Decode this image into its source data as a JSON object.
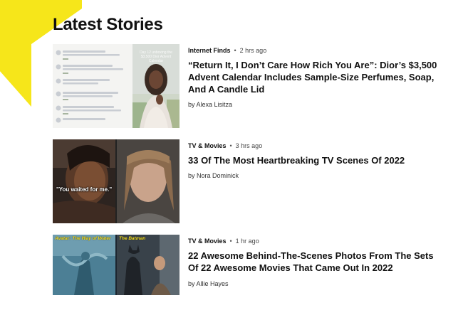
{
  "section": {
    "title": "Latest Stories"
  },
  "colors": {
    "accent_yellow": "#f6e61a",
    "text": "#111111",
    "meta": "#444444"
  },
  "stories": [
    {
      "category": "Internet Finds",
      "separator": "•",
      "time": "2 hrs ago",
      "headline": "“Return It, I Don’t Care How Rich You Are”: Dior’s $3,500 Advent Calendar Includes Sample-Size Perfumes, Soap, And A Candle Lid",
      "byline": "by Alexa Lisitza",
      "thumb_overlay": "Day 12 unboxing the $3,500 Dior Advent Calendar"
    },
    {
      "category": "TV & Movies",
      "separator": "•",
      "time": "3 hrs ago",
      "headline": "33 Of The Most Heartbreaking TV Scenes Of 2022",
      "byline": "by Nora Dominick",
      "thumb_caption": "\"You waited for me.\""
    },
    {
      "category": "TV & Movies",
      "separator": "•",
      "time": "1 hr ago",
      "headline": "22 Awesome Behind-The-Scenes Photos From The Sets Of 22 Awesome Movies That Came Out In 2022",
      "byline": "by Allie Hayes",
      "thumb_label_left": "Avatar: The Way of Water",
      "thumb_label_right": "The Batman"
    }
  ]
}
